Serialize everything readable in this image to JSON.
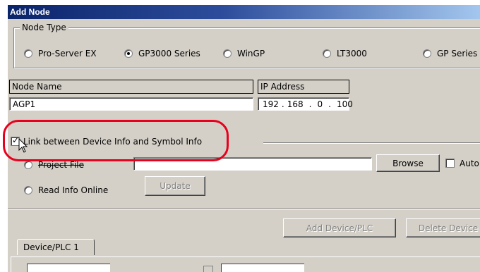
{
  "dialog": {
    "title": "Add Node"
  },
  "node_type": {
    "label": "Node Type",
    "options": [
      {
        "label": "Pro-Server EX",
        "selected": false
      },
      {
        "label": "GP3000 Series",
        "selected": true
      },
      {
        "label": "WinGP",
        "selected": false
      },
      {
        "label": "LT3000",
        "selected": false
      },
      {
        "label": "GP Series",
        "selected": false
      }
    ]
  },
  "node_name": {
    "header": "Node Name",
    "value": "AGP1"
  },
  "ip_address": {
    "header": "IP Address",
    "octets": [
      "192",
      "168",
      "0",
      "100"
    ]
  },
  "link_info": {
    "label": "Link between Device Info and Symbol Info",
    "checked": true
  },
  "project_file": {
    "label": "Project File",
    "value": "",
    "browse_label": "Browse",
    "auto_label": "Auto"
  },
  "read_online": {
    "label": "Read Info Online",
    "update_label": "Update"
  },
  "device_buttons": {
    "add_label": "Add Device/PLC",
    "delete_label": "Delete Device"
  },
  "tabs": [
    {
      "label": "Device/PLC 1"
    }
  ],
  "colors": {
    "highlight": "#e8001c",
    "title_start": "#0a246a",
    "title_end": "#a6caf0",
    "face": "#d4d0c8"
  }
}
